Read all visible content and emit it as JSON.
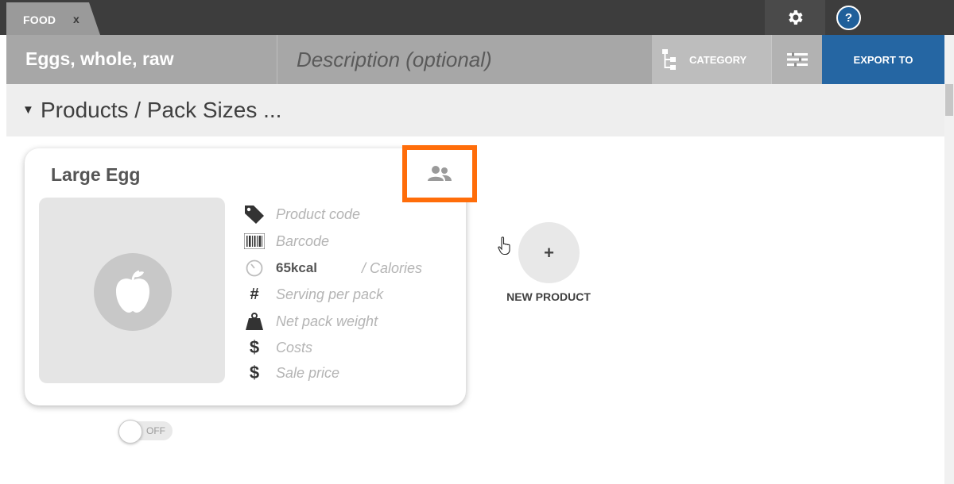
{
  "topbar": {
    "tab_label": "FOOD",
    "tab_close": "x",
    "settings_icon": "gear-icon",
    "help_label": "?"
  },
  "header": {
    "item_name": "Eggs, whole, raw",
    "description_placeholder": "Description (optional)",
    "category_label": "CATEGORY",
    "export_label": "EXPORT TO"
  },
  "section": {
    "title": "Products / Pack Sizes ..."
  },
  "product": {
    "name": "Large Egg",
    "toggle_label": "OFF",
    "fields": {
      "product_code": "Product code",
      "barcode": "Barcode",
      "calories_value": "65kcal",
      "calories_unit": "/  Calories",
      "serving": "Serving per pack",
      "net_weight": "Net pack weight",
      "costs": "Costs",
      "sale_price": "Sale price"
    }
  },
  "new_product": {
    "plus": "+",
    "label": "NEW PRODUCT"
  },
  "colors": {
    "accent_export": "#2566a3",
    "highlight": "#ff6d0a",
    "topbar": "#3d3d3d",
    "header": "#a7a7a7"
  }
}
